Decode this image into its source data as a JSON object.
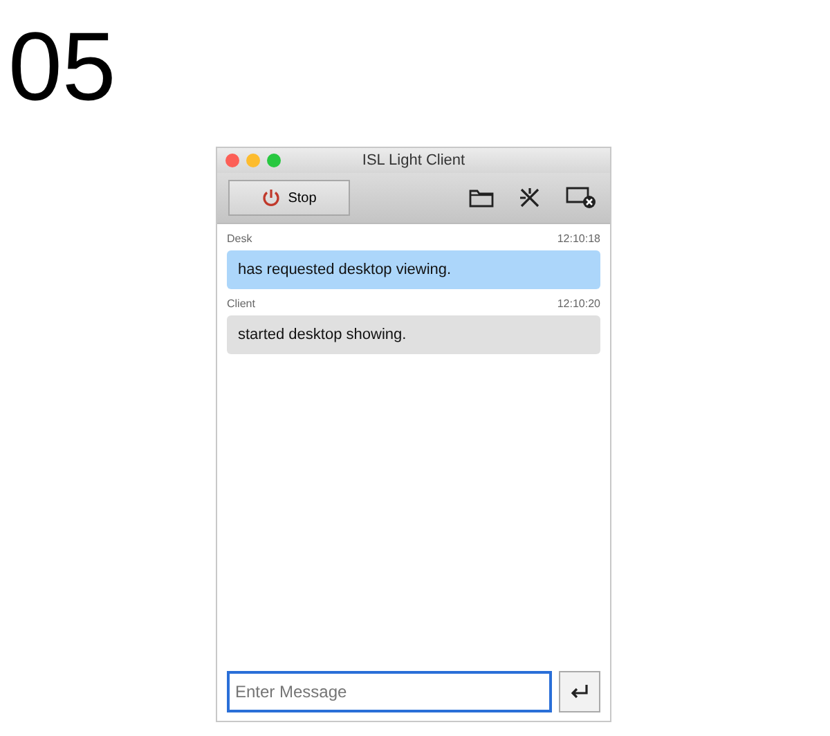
{
  "step_number": "05",
  "window": {
    "title": "ISL Light Client"
  },
  "toolbar": {
    "stop_button": "Stop"
  },
  "messages": [
    {
      "sender": "Desk",
      "time": "12:10:18",
      "text": "has requested desktop viewing.",
      "color": "#acd6fa"
    },
    {
      "sender": "Client",
      "time": "12:10:20",
      "text": "started desktop showing.",
      "color": "#e0e0e0"
    }
  ],
  "composer": {
    "placeholder": "Enter Message"
  }
}
